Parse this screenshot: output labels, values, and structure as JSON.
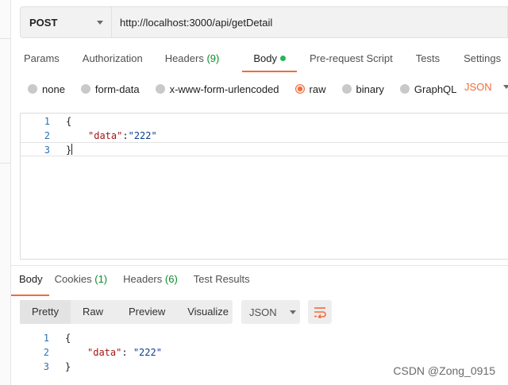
{
  "request": {
    "method": "POST",
    "url": "http://localhost:3000/api/getDetail"
  },
  "request_tabs": [
    {
      "label": "Params"
    },
    {
      "label": "Authorization"
    },
    {
      "label": "Headers",
      "count": "(9)"
    },
    {
      "label": "Body",
      "active": true
    },
    {
      "label": "Pre-request Script"
    },
    {
      "label": "Tests"
    },
    {
      "label": "Settings"
    }
  ],
  "body_types": [
    {
      "label": "none"
    },
    {
      "label": "form-data"
    },
    {
      "label": "x-www-form-urlencoded"
    },
    {
      "label": "raw",
      "selected": true
    },
    {
      "label": "binary"
    },
    {
      "label": "GraphQL"
    }
  ],
  "body_format": "JSON",
  "request_body": {
    "lines": [
      {
        "n": "1",
        "text": "{"
      },
      {
        "n": "2",
        "key": "\"data\"",
        "sep": ":",
        "value": "\"222\""
      },
      {
        "n": "3",
        "text": "}"
      }
    ]
  },
  "response_tabs": [
    {
      "label": "Body",
      "active": true
    },
    {
      "label": "Cookies",
      "count": "(1)"
    },
    {
      "label": "Headers",
      "count": "(6)"
    },
    {
      "label": "Test Results"
    }
  ],
  "view_modes": [
    {
      "label": "Pretty",
      "active": true
    },
    {
      "label": "Raw"
    },
    {
      "label": "Preview"
    },
    {
      "label": "Visualize"
    }
  ],
  "response_format": "JSON",
  "response_body": {
    "lines": [
      {
        "n": "1",
        "text": "{"
      },
      {
        "n": "2",
        "key": "\"data\"",
        "sep": ": ",
        "value": "\"222\""
      },
      {
        "n": "3",
        "text": "}"
      }
    ]
  },
  "watermark": "CSDN @Zong_0915",
  "colors": {
    "accent": "#f26b3a",
    "count_green": "#0c8a2b",
    "body_dot": "#26b65a",
    "json_key": "#a31515",
    "json_value": "#0b3d91",
    "line_number": "#2f6fb4"
  },
  "icons": {
    "method_dropdown": "chevron-down-icon",
    "format_dropdown": "chevron-down-icon",
    "wrap": "wrap-lines-icon"
  }
}
